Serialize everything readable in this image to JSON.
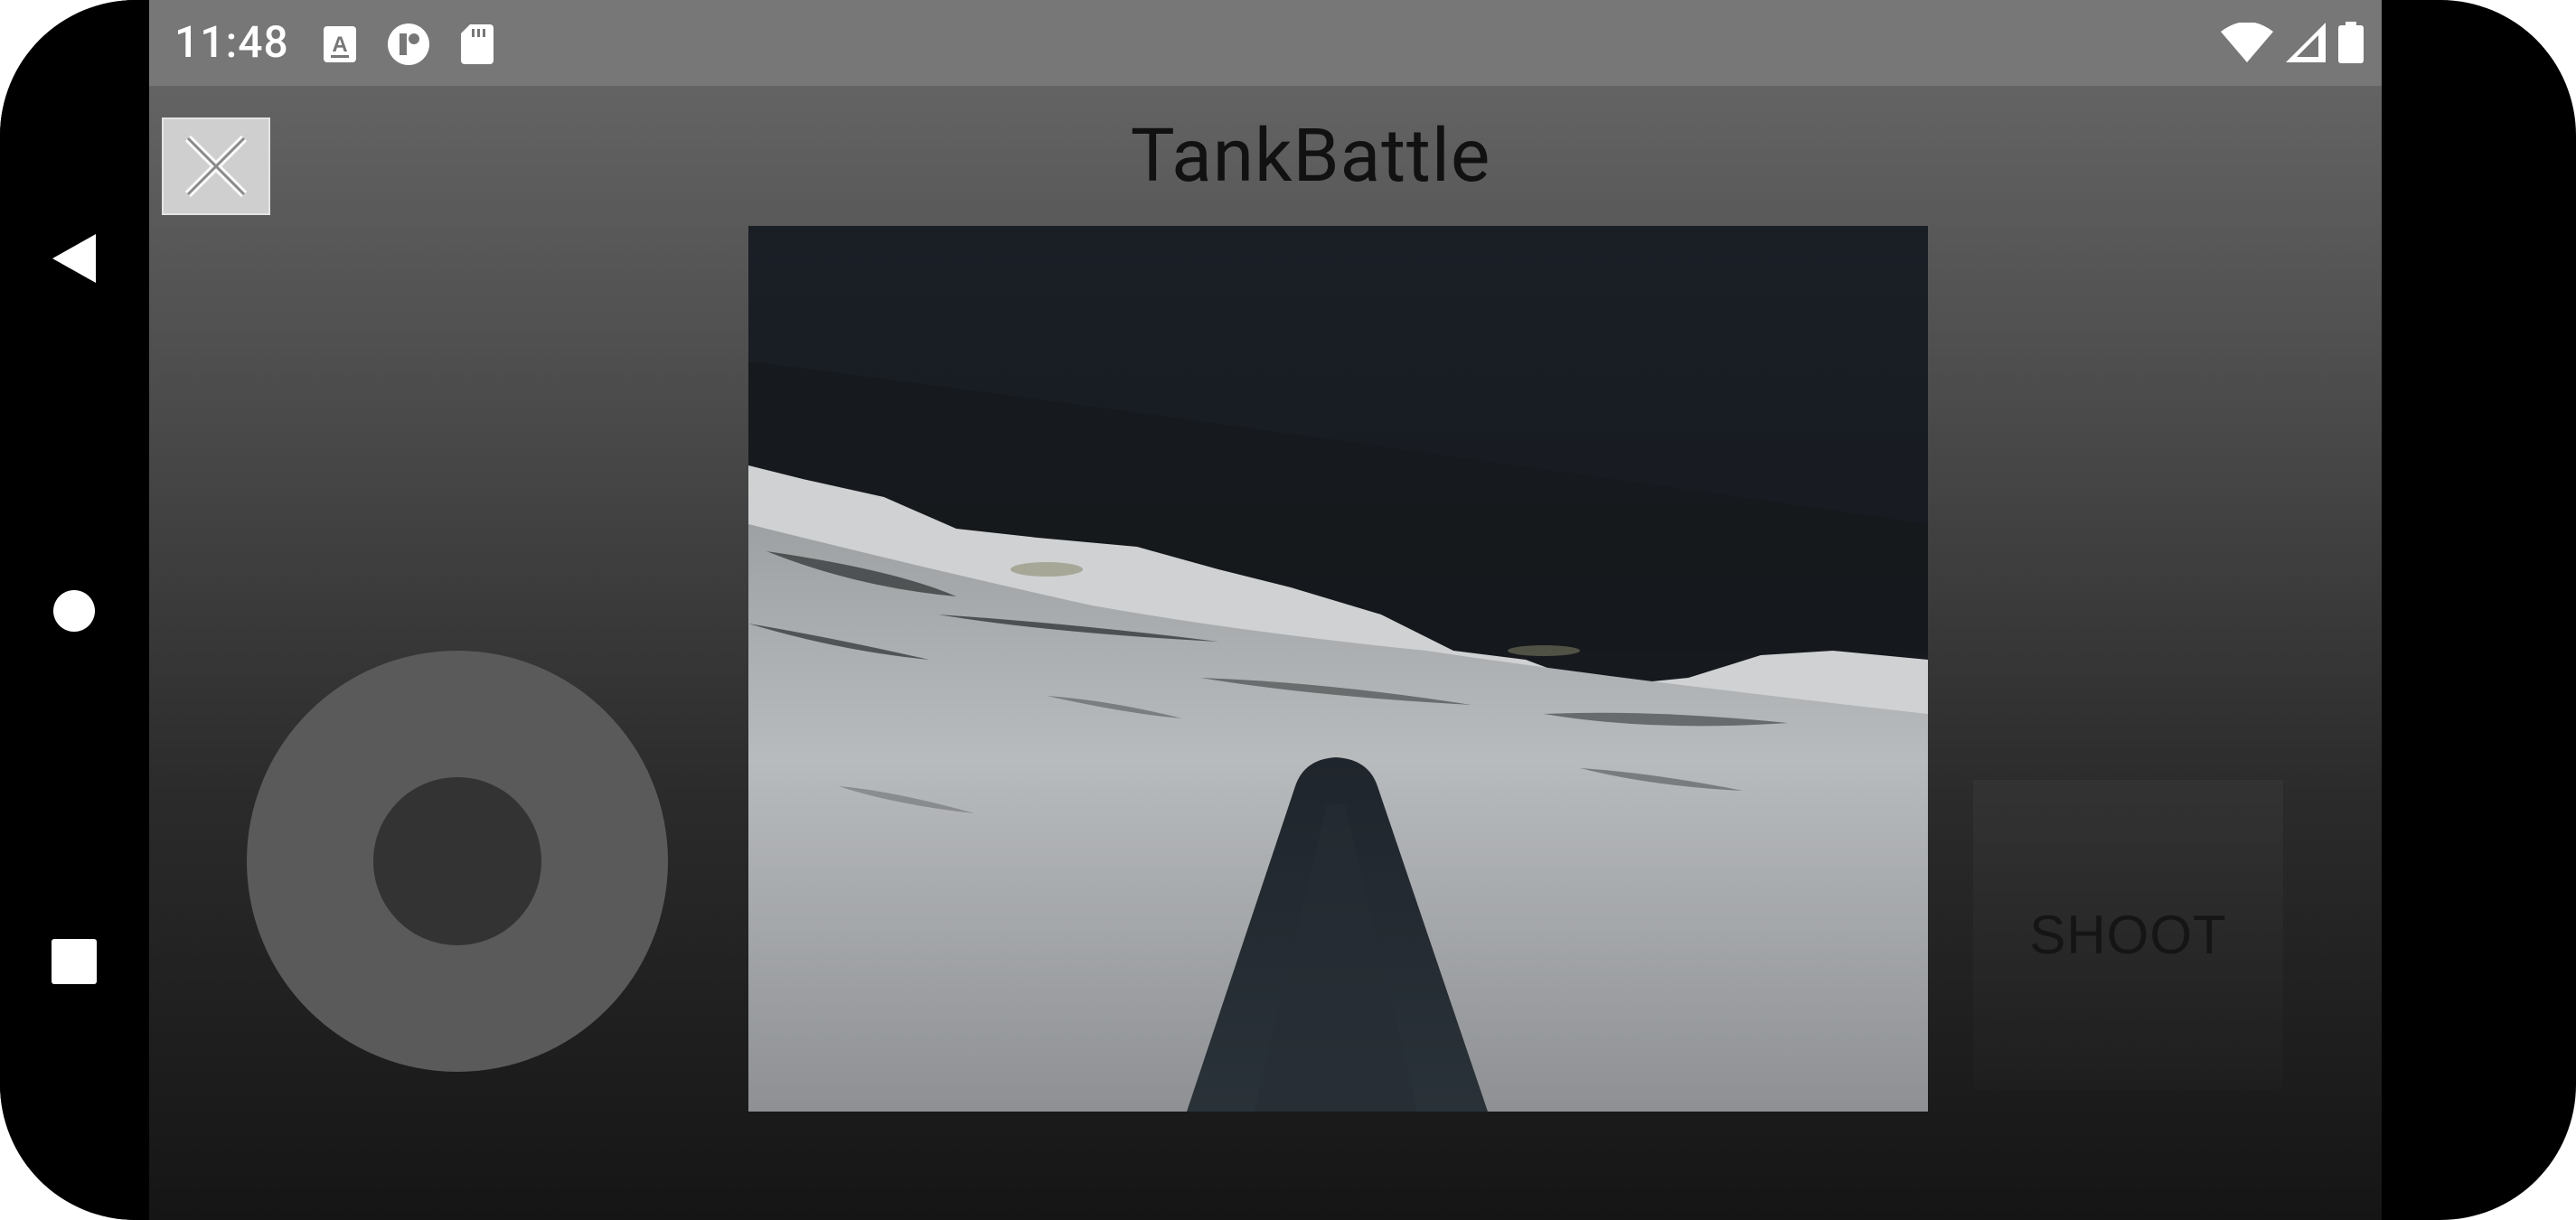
{
  "status_bar": {
    "time": "11:48",
    "left_icons": [
      "keyboard-a-icon",
      "notification-icon",
      "sd-card-icon"
    ],
    "right_icons": [
      "wifi-icon",
      "cell-signal-icon",
      "battery-icon"
    ]
  },
  "navigation": {
    "back_icon": "back-triangle-icon",
    "home_icon": "home-circle-icon",
    "recents_icon": "recents-square-icon"
  },
  "app": {
    "title": "TankBattle",
    "close_icon": "close-x-icon"
  },
  "controls": {
    "shoot_label": "SHOOT",
    "joystick_icon": "joystick"
  },
  "colors": {
    "status_bar": "#777777",
    "close_button": "#cfcfcf",
    "joystick_ring": "#5a5a5a",
    "joystick_knob": "#333333",
    "shoot_button": "#2a2a2a"
  }
}
